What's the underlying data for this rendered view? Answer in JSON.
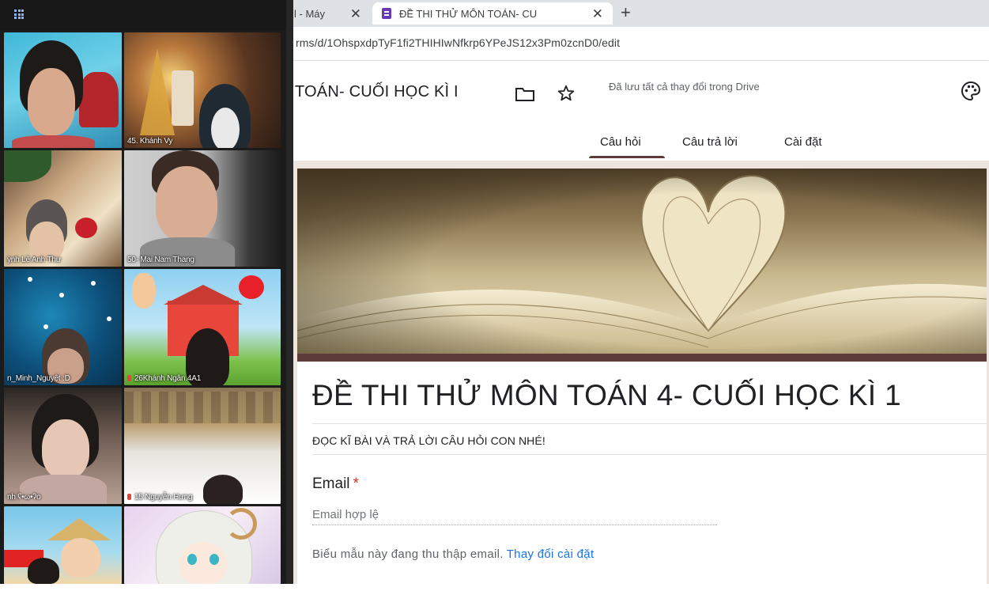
{
  "video_call": {
    "participants": [
      {
        "name": ""
      },
      {
        "name": "45. Khánh Vy"
      },
      {
        "name": "ỳnh Lê Anh Thư"
      },
      {
        "name": "50- Mai Nam Thang"
      },
      {
        "name": "n_Minh_Nguyệt :D"
      },
      {
        "name": "26Khánh Ngân.4A1"
      },
      {
        "name": "nh ʕ•ω•ʔo"
      },
      {
        "name": "15 Nguyễn Hưng"
      },
      {
        "name": ""
      },
      {
        "name": ""
      }
    ]
  },
  "browser": {
    "tabs": [
      {
        "label": "l - Máy"
      },
      {
        "label": "ĐỀ THI THỬ MÔN TOÁN- CU"
      }
    ],
    "new_tab_symbol": "+",
    "close_symbol": "✕",
    "url": "rms/d/1OhspxdpTyF1fi2THIHIwNfkrp6YPeJS12x3Pm0zcnD0/edit"
  },
  "forms_header": {
    "doc_title": "TOÁN- CUỐI HỌC KÌ I",
    "save_status": "Đã lưu tất cả thay đổi trong Drive",
    "tabs": {
      "questions": "Câu hỏi",
      "responses": "Câu trả lời",
      "settings": "Cài đặt"
    },
    "accent_color": "#5e3b3b"
  },
  "form": {
    "title": "ĐỀ THI THỬ MÔN TOÁN 4- CUỐI HỌC KÌ 1",
    "description": "ĐỌC KĨ BÀI VÀ TRẢ LỜI CÂU HỎI CON NHÉ!",
    "email_label": "Email",
    "required_mark": "*",
    "email_placeholder": "Email hợp lệ",
    "collect_note": "Biểu mẫu này đang thu thập email.",
    "change_settings_link": "Thay đổi cài đặt"
  },
  "icons": [
    "grid-icon",
    "forms-favicon",
    "close-icon",
    "new-tab-icon",
    "folder-icon",
    "star-icon",
    "palette-icon",
    "mic-off-icon"
  ]
}
